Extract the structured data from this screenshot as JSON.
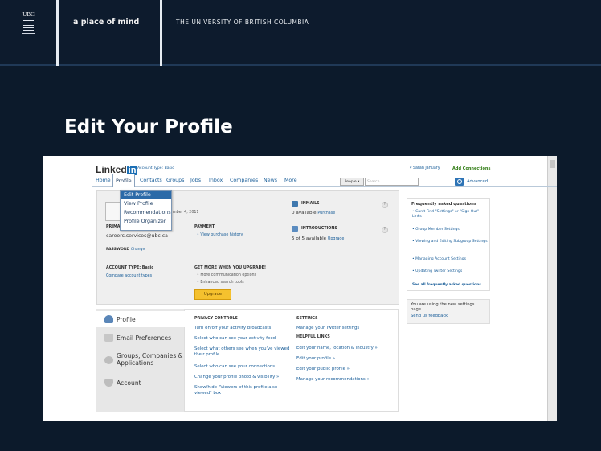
{
  "slide": {
    "tagline": "a place of mind",
    "university": "THE UNIVERSITY OF BRITISH COLUMBIA",
    "logo_text": "UBC",
    "title": "Edit Your Profile"
  },
  "linkedin": {
    "logo_word": "Linked",
    "logo_in": "in",
    "account_type": "Account Type: Basic",
    "user_name": "▾ Sarah January",
    "add_connections": "Add Connections",
    "nav": [
      "Home",
      "Profile",
      "Contacts",
      "Groups",
      "Jobs",
      "Inbox",
      "Companies",
      "News",
      "More"
    ],
    "search_scope": "People ▾",
    "search_placeholder": "Search...",
    "advanced": "Advanced",
    "profile_menu": [
      "Edit Profile",
      "View Profile",
      "Recommendations",
      "Profile Organizer"
    ],
    "member_since": "mber 4, 2011",
    "primary_label": "PRIMA",
    "email": "careers.services@ubc.ca",
    "password_label": "PASSWORD",
    "password_change": "Change",
    "payment_label": "PAYMENT",
    "purchase_history": "• View purchase history",
    "account_type_label": "ACCOUNT TYPE: Basic",
    "compare_types": "Compare account types",
    "get_more": "GET MORE WHEN YOU UPGRADE!",
    "more_comm": "• More communication options",
    "enhanced_search": "• Enhanced search tools",
    "upgrade_button": "Upgrade",
    "inmails_label": "INMAILS",
    "inmails_available": "0 available",
    "purchase": "Purchase",
    "intros_label": "INTRODUCTIONS",
    "intros_available": "5 of 5 available",
    "upgrade_link": "Upgrade",
    "help_glyph": "?",
    "faq_title": "Frequently asked questions",
    "faq_items": [
      "• Can't Find \"Settings\" or \"Sign Out\" Links",
      "• Group Member Settings",
      "• Viewing and Editing Subgroup Settings",
      "• Managing Account Settings",
      "• Updating Twitter Settings"
    ],
    "faq_all": "See all frequently asked questions",
    "new_settings": "You are using the new settings page.",
    "feedback": "Send us feedback",
    "settings_tabs": [
      "Profile",
      "Email Preferences",
      "Groups, Companies & Applications",
      "Account"
    ],
    "privacy_title": "PRIVACY CONTROLS",
    "privacy_links": [
      "Turn on/off your activity broadcasts",
      "Select who can see your activity feed",
      "Select what others see when you've viewed their profile",
      "Select who can see your connections",
      "Change your profile photo & visibility »",
      "Show/hide \"Viewers of this profile also viewed\" box"
    ],
    "settings_title": "SETTINGS",
    "twitter_link": "Manage your Twitter settings",
    "helpful_title": "HELPFUL LINKS",
    "helpful_links": [
      "Edit your name, location & industry »",
      "Edit your profile »",
      "Edit your public profile »",
      "Manage your recommendations »"
    ]
  }
}
